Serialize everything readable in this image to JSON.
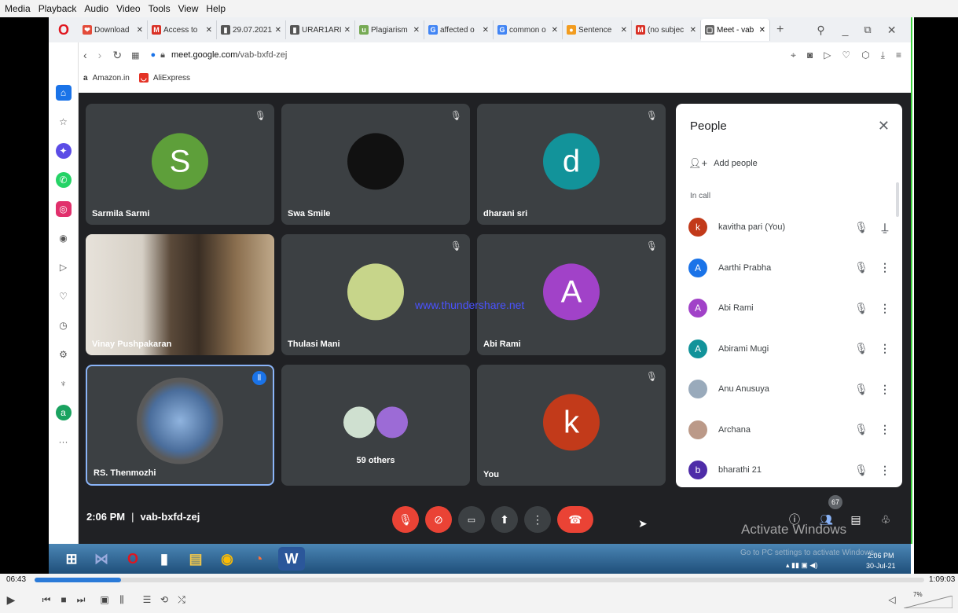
{
  "player": {
    "menu": [
      "Media",
      "Playback",
      "Audio",
      "Video",
      "Tools",
      "View",
      "Help"
    ],
    "time_elapsed": "06:43",
    "time_total": "1:09:03",
    "progress": 0.097,
    "volume_label": "7%"
  },
  "browser": {
    "tabs": [
      {
        "label": "Download",
        "icon": "download-icon",
        "color": "#e34b3a",
        "glyph": "❤"
      },
      {
        "label": "Access to",
        "icon": "gmail-icon",
        "color": "#d93025",
        "glyph": "M"
      },
      {
        "label": "29.07.2021",
        "icon": "doc-icon",
        "color": "#555",
        "glyph": "▮"
      },
      {
        "label": "URAR1ARI",
        "icon": "doc-icon",
        "color": "#555",
        "glyph": "▮"
      },
      {
        "label": "Plagiarism",
        "icon": "ust-icon",
        "color": "#7a5",
        "glyph": "u"
      },
      {
        "label": "affected o",
        "icon": "google-icon",
        "color": "#4285f4",
        "glyph": "G"
      },
      {
        "label": "common o",
        "icon": "google-icon",
        "color": "#4285f4",
        "glyph": "G"
      },
      {
        "label": "Sentence",
        "icon": "sentence-icon",
        "color": "#f29c1f",
        "glyph": "●"
      },
      {
        "label": "(no subjec",
        "icon": "gmail-icon",
        "color": "#d93025",
        "glyph": "M"
      },
      {
        "label": "Meet - vab",
        "icon": "meet-icon",
        "color": "#666",
        "glyph": "▢"
      }
    ],
    "url_domain": "meet.google.com",
    "url_path": "/vab-bxfd-zej",
    "bookmarks": [
      "Amazon.in",
      "AliExpress"
    ]
  },
  "tiles": [
    {
      "name": "Sarmila Sarmi",
      "initial": "S",
      "color": "#5e9f3a",
      "muted": true
    },
    {
      "name": "Swa Smile",
      "initial": "",
      "color": "#111",
      "muted": true
    },
    {
      "name": "dharani sri",
      "initial": "d",
      "color": "#12939a",
      "muted": true
    },
    {
      "name": "Vinay Pushpakaran",
      "initial": "",
      "color": "#6b5a44",
      "muted": false
    },
    {
      "name": "Thulasi Mani",
      "initial": "",
      "color": "#c7d58a",
      "muted": true
    },
    {
      "name": "Abi Rami",
      "initial": "A",
      "color": "#a142c8",
      "muted": true
    },
    {
      "name": "RS. Thenmozhi",
      "initial": "",
      "color": "#4a6d9b",
      "muted": false
    },
    {
      "name": "59 others",
      "initial": "",
      "color": "#8c8",
      "muted": false
    },
    {
      "name": "You",
      "initial": "k",
      "color": "#c23a1a",
      "muted": true
    }
  ],
  "watermark": "www.thundershare.net",
  "people": {
    "title": "People",
    "add_label": "Add people",
    "section": "In call",
    "participants": [
      {
        "name": "kavitha pari (You)",
        "initial": "k",
        "color": "#c23a1a",
        "action": "pin-icon"
      },
      {
        "name": "Aarthi Prabha",
        "initial": "A",
        "color": "#1a73e8",
        "action": "more-icon"
      },
      {
        "name": "Abi Rami",
        "initial": "A",
        "color": "#a142c8",
        "action": "more-icon"
      },
      {
        "name": "Abirami Mugi",
        "initial": "A",
        "color": "#12939a",
        "action": "more-icon"
      },
      {
        "name": "Anu Anusuya",
        "initial": "",
        "color": "#9ab",
        "action": "more-icon"
      },
      {
        "name": "Archana",
        "initial": "",
        "color": "#b98",
        "action": "more-icon"
      },
      {
        "name": "bharathi 21",
        "initial": "b",
        "color": "#4e2ca8",
        "action": "more-icon"
      }
    ]
  },
  "meeting": {
    "time": "2:06 PM",
    "separator": "|",
    "code": "vab-bxfd-zej",
    "participant_count": "67"
  },
  "windows": {
    "activate_title": "Activate Windows",
    "activate_sub": "Go to PC settings to activate Windows.",
    "clock_time": "2:06 PM",
    "clock_date": "30-Jul-21"
  }
}
